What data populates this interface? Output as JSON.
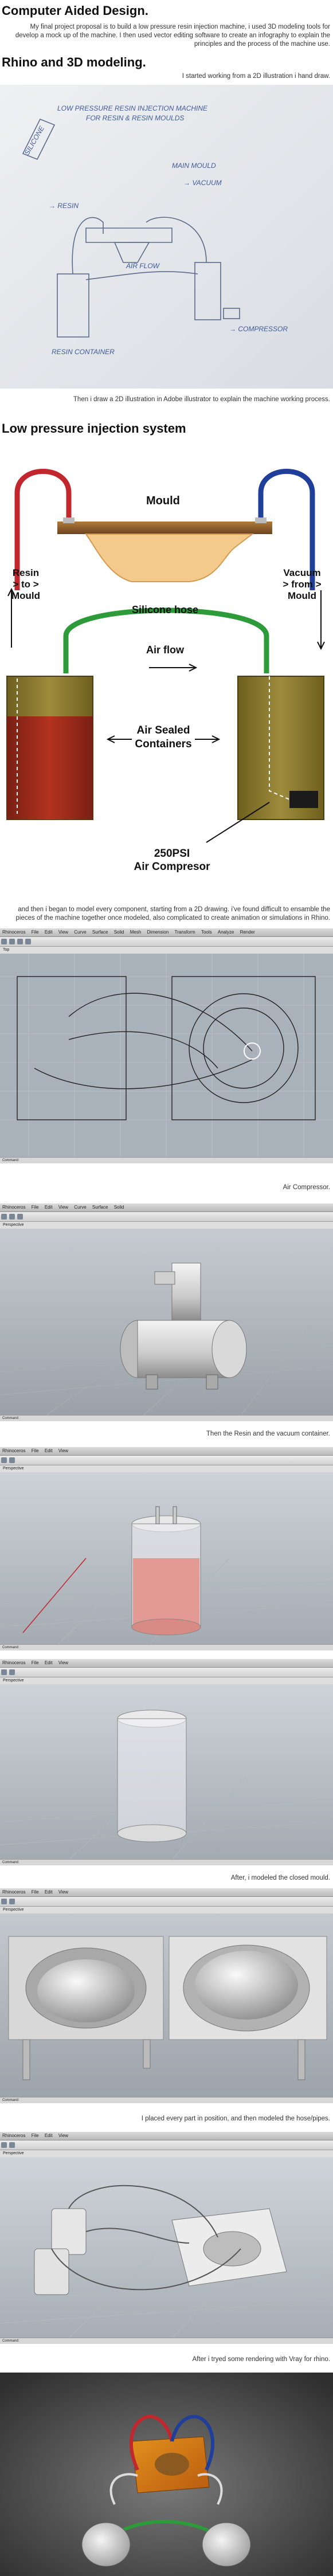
{
  "title": "Computer Aided Design.",
  "intro": "My final project proposal is to build a low pressure resin injection machine, i used 3D modeling tools for develop a mock up of the machine. I then used vector editing software to create an infography to explain the principles and the process of the machine use.",
  "section_rhino": "Rhino and 3D modeling.",
  "caption_hand_draw": "I started working from a 2D illustration i hand draw.",
  "sketch": {
    "title_line1": "LOW PRESSURE RESIN INJECTION MACHINE",
    "title_line2": "FOR RESIN & RESIN MOULDS",
    "lbl_resin": "→ RESIN",
    "lbl_mould": "MAIN MOULD",
    "lbl_vacuum": "→ VACUUM",
    "lbl_air_flow": "AIR FLOW",
    "lbl_resin_container": "RESIN CONTAINER",
    "lbl_compressor": "→ COMPRESSOR",
    "side_note": "SILICONE"
  },
  "caption_illustrator": "Then i draw a 2D illustration in Adobe illustrator to explain the machine working process.",
  "section_injection": "Low pressure injection system",
  "info": {
    "mould": "Mould",
    "resin_l1": "Resin",
    "resin_l2": "> to >",
    "resin_l3": "Mould",
    "vacuum_l1": "Vacuum",
    "vacuum_l2": "> from >",
    "vacuum_l3": "Mould",
    "silicone": "Silicone hose",
    "airflow": "Air flow",
    "containers_l1": "Air Sealed",
    "containers_l2": "Containers",
    "compressor_l1": "250PSI",
    "compressor_l2": "Air Compresor"
  },
  "caption_model_every": "and then i began to model every component, starting from a 2D drawing. i've found difficult to ensamble the pieces of the machine together once modeled, also complicated to create animation or simulations in Rhino.",
  "caption_compressor": "Air Compressor.",
  "caption_containers": "Then the Resin and the vacuum container.",
  "caption_mould": "After, i modeled the closed mould.",
  "caption_pipes": "I placed every part in position, and then modeled the hose/pipes.",
  "caption_vray": "After i tryed some rendering with Vray for rhino.",
  "rhino": {
    "app": "Rhinoceros",
    "menu": [
      "File",
      "Edit",
      "View",
      "Curve",
      "Surface",
      "Solid",
      "Mesh",
      "Dimension",
      "Transform",
      "Tools",
      "Analyze",
      "Render",
      "Panels",
      "Help"
    ],
    "tabs": [
      "Perspective",
      "Top",
      "Front",
      "Right"
    ],
    "status": "Command:"
  },
  "colors": {
    "red_hose": "#c1272d",
    "blue_hose": "#1f3f9a",
    "green_hose": "#2e9b3a",
    "container": "#8a7a2a",
    "resin": "#a32a1a",
    "mould": "#8b5a2b"
  }
}
